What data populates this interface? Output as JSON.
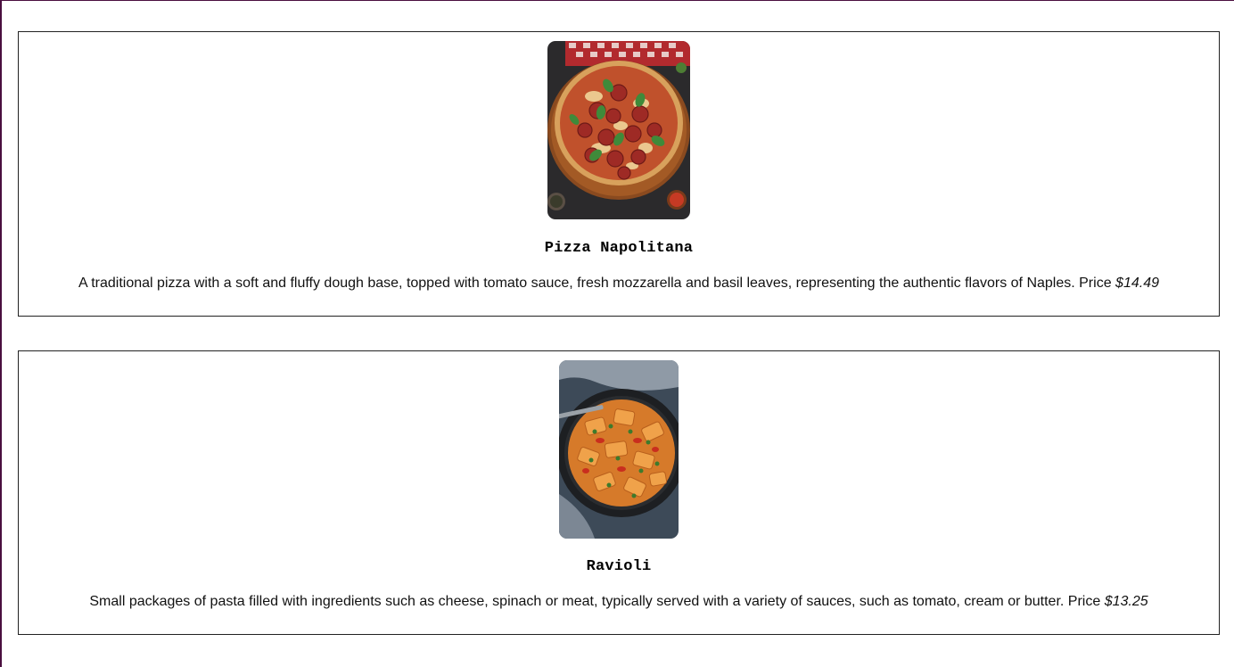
{
  "menu": {
    "items": [
      {
        "name": "Pizza Napolitana",
        "description": "A traditional pizza with a soft and fluffy dough base, topped with tomato sauce, fresh mozzarella and basil leaves, representing the authentic flavors of Naples. Price",
        "price": "$14.49",
        "photo": "pizza-napolitana-photo"
      },
      {
        "name": "Ravioli",
        "description": "Small packages of pasta filled with ingredients such as cheese, spinach or meat, typically served with a variety of sauces, such as tomato, cream or butter. Price",
        "price": "$13.25",
        "photo": "ravioli-photo"
      }
    ]
  },
  "colors": {
    "frame_edge": "#4a0f3f",
    "card_border": "#222222",
    "text": "#111111"
  }
}
